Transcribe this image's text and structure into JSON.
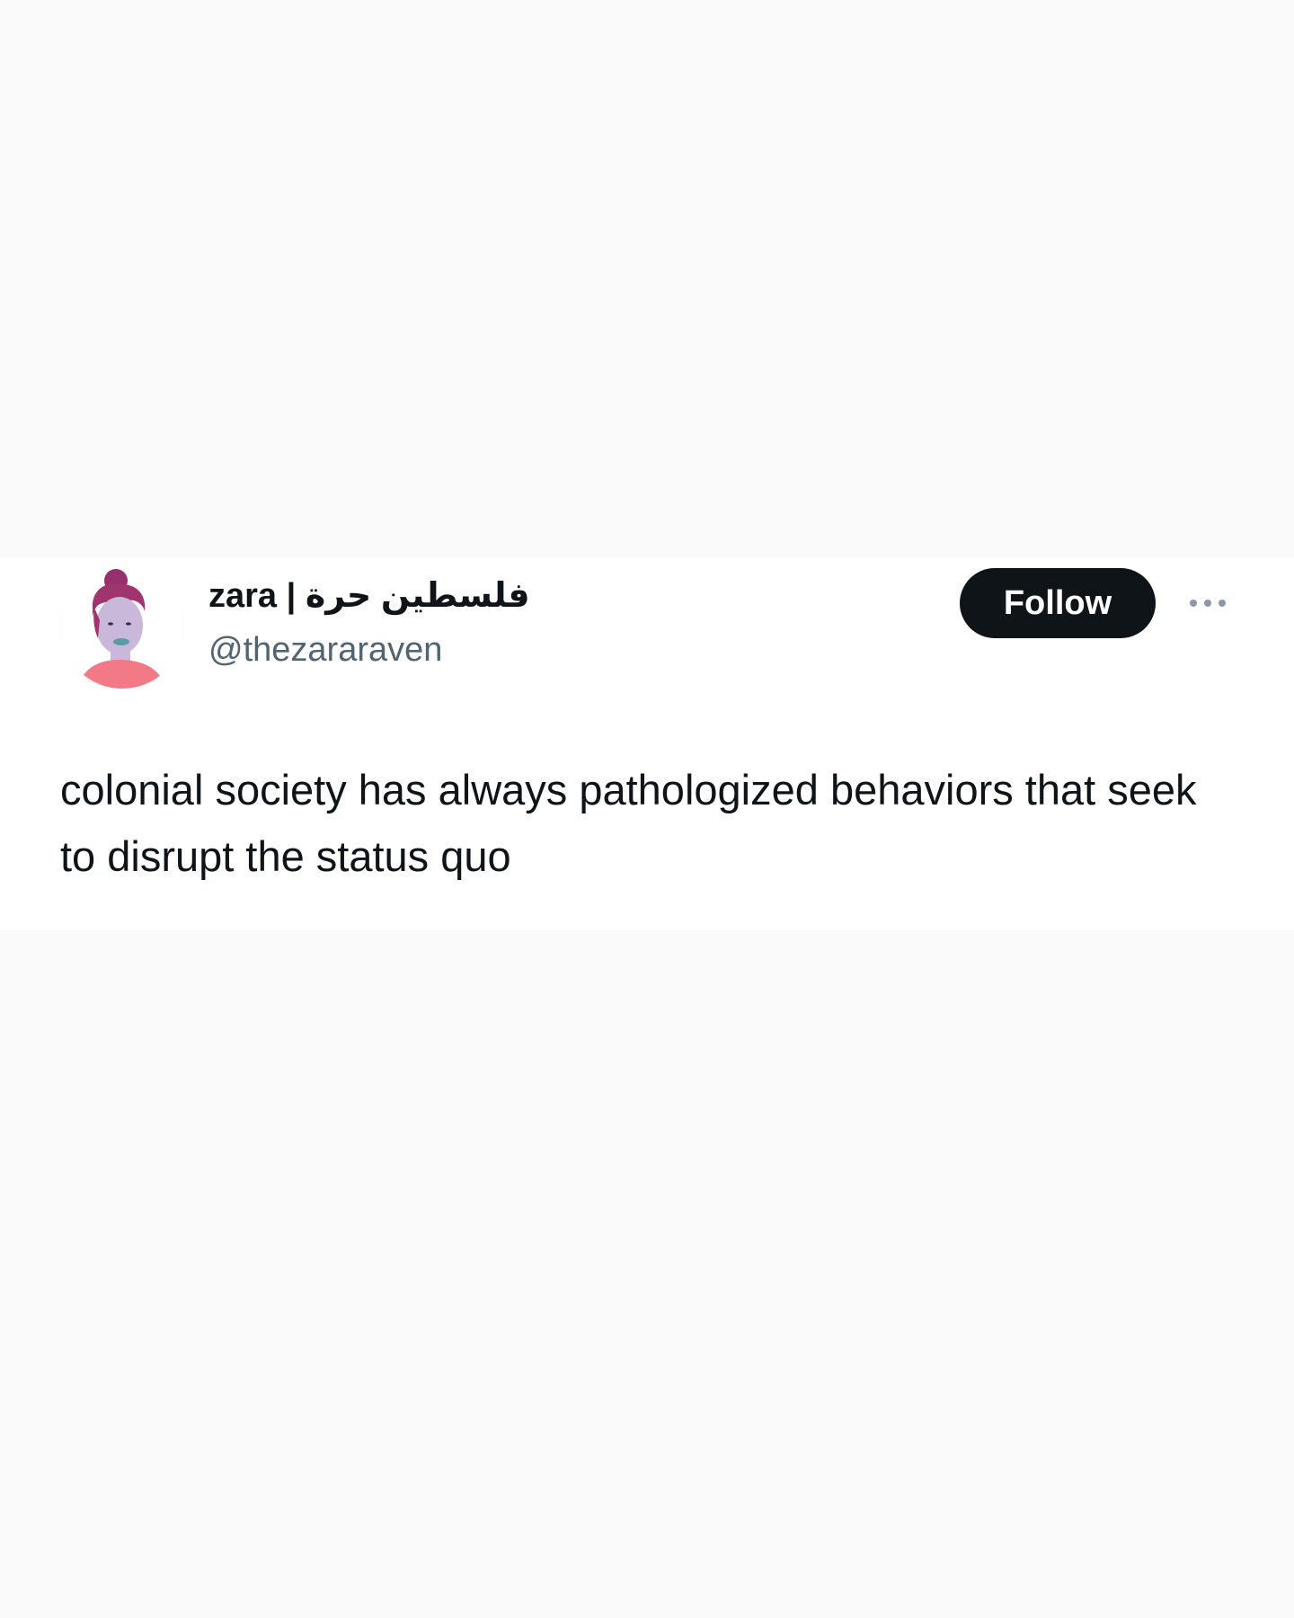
{
  "tweet": {
    "author": {
      "display_name": "zara | فلسطين حرة",
      "handle": "@thezararaven",
      "avatar_icon": "illustrated-portrait-avatar"
    },
    "follow_label": "Follow",
    "more_icon": "ellipsis-icon",
    "text": "colonial society has always pathologized behaviors that seek to disrupt the status quo"
  },
  "colors": {
    "text_primary": "#0f1419",
    "text_secondary": "#536471",
    "button_bg": "#0f1419",
    "button_text": "#ffffff"
  }
}
